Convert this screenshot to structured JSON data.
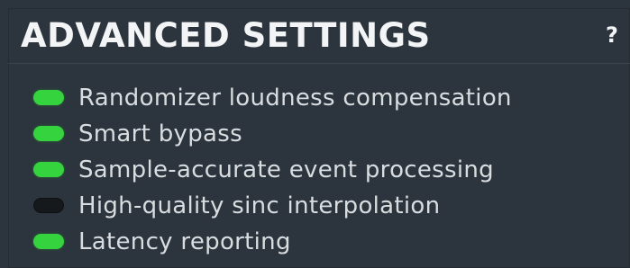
{
  "panel": {
    "title": "ADVANCED SETTINGS",
    "help_label": "?"
  },
  "settings": [
    {
      "label": "Randomizer loudness compensation",
      "enabled": true
    },
    {
      "label": "Smart bypass",
      "enabled": true
    },
    {
      "label": "Sample-accurate event processing",
      "enabled": true
    },
    {
      "label": "High-quality sinc interpolation",
      "enabled": false
    },
    {
      "label": "Latency reporting",
      "enabled": true
    }
  ],
  "colors": {
    "background": "#2c353d",
    "led_on": "#35d43f",
    "led_off": "#15191c",
    "text": "#d9dde0",
    "title": "#f2f4f5"
  }
}
